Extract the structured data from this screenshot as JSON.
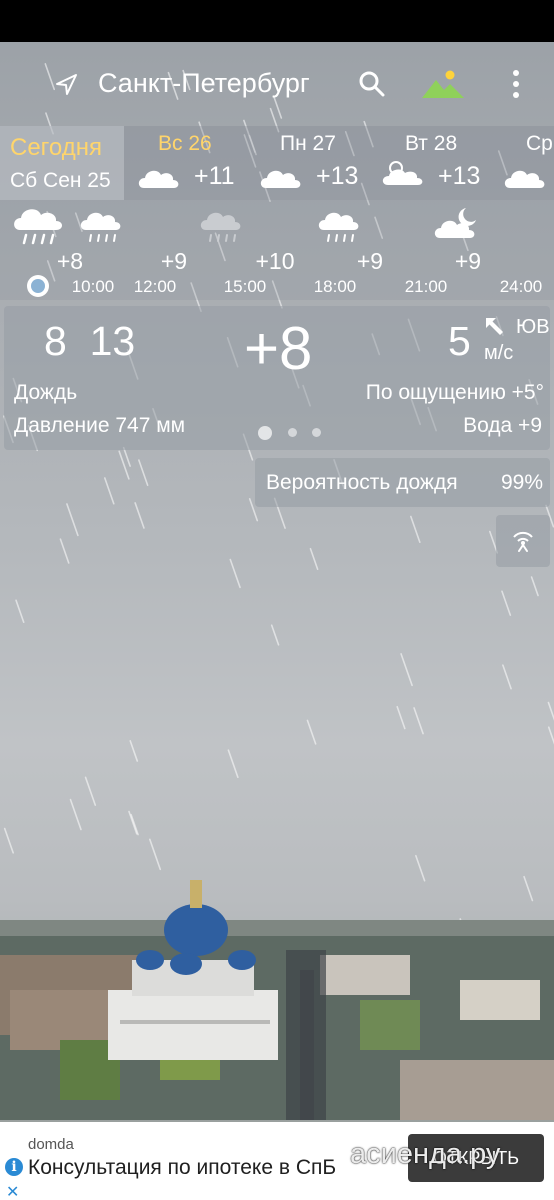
{
  "header": {
    "city": "Санкт-Петербург",
    "icons": [
      "location-arrow-icon",
      "search-icon",
      "landscape-icon",
      "more-vert-icon"
    ]
  },
  "days": {
    "today": {
      "label": "Сегодня",
      "date": "Сб Сен 25"
    },
    "items": [
      {
        "name": "Вс 26",
        "temp": "+11",
        "icon": "cloud-icon",
        "color": "#ffd56b"
      },
      {
        "name": "Пн 27",
        "temp": "+13",
        "icon": "cloud-icon"
      },
      {
        "name": "Вт 28",
        "temp": "+13",
        "icon": "partly-cloudy-icon"
      },
      {
        "name": "Ср",
        "temp": "",
        "icon": "cloud-icon"
      }
    ]
  },
  "hourly": [
    {
      "time": "",
      "temp": "+8",
      "icon": "rain-cloud-icon"
    },
    {
      "time": "10:00",
      "temp": "",
      "icon": "rain-cloud-icon"
    },
    {
      "time": "12:00",
      "temp": "+9",
      "icon": "rain-cloud-icon"
    },
    {
      "time": "15:00",
      "temp": "+10",
      "icon": "rain-cloud-grey-icon"
    },
    {
      "time": "18:00",
      "temp": "+9",
      "icon": "rain-cloud-icon"
    },
    {
      "time": "21:00",
      "temp": "+9",
      "icon": "night-cloud-icon"
    },
    {
      "time": "24:00",
      "temp": "",
      "icon": ""
    }
  ],
  "current": {
    "min": "8",
    "max": "13",
    "temp": "+8",
    "wind_speed": "5",
    "wind_dir": "ЮВ",
    "wind_unit": "м/с",
    "condition": "Дождь",
    "feels_like": "По ощущению +5°",
    "pressure": "Давление 747 мм",
    "water": "Вода +9",
    "pager_active": 0
  },
  "rain_chance": {
    "label": "Вероятность дождя",
    "value": "99%"
  },
  "ad": {
    "source": "domda",
    "text": "Консультация по ипотеке в СпБ",
    "button": "ОТКРЫТЬ"
  },
  "watermark": "асиенда.ру",
  "colors": {
    "accent": "#ffd56b",
    "ad_info": "#2a8ad4"
  }
}
